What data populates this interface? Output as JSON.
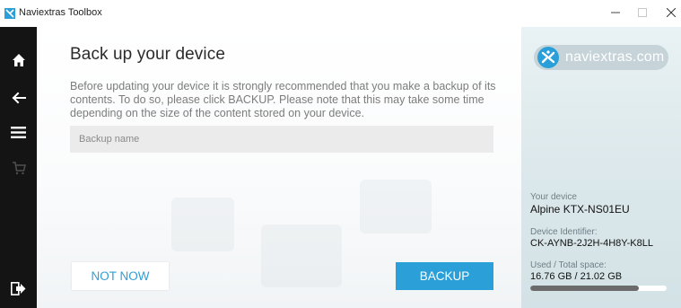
{
  "window": {
    "title": "Naviextras Toolbox",
    "controls": [
      "minimize",
      "maximize",
      "close"
    ]
  },
  "sidebar": {
    "items": [
      {
        "icon": "home-icon"
      },
      {
        "icon": "back-arrow-icon"
      },
      {
        "icon": "menu-icon"
      },
      {
        "icon": "cart-icon"
      },
      {
        "icon": "exit-icon"
      }
    ]
  },
  "main": {
    "title": "Back up your device",
    "intro": "Before updating your device it is strongly recommended that you make a backup of its contents. To do so, please click BACKUP. Please note that this may take some time depending on the size of the content stored on your device.",
    "backup_name": {
      "placeholder": "Backup name",
      "value": ""
    },
    "not_now_label": "NOT NOW",
    "backup_label": "BACKUP"
  },
  "panel": {
    "brand": "naviextras.com",
    "device_label": "Your device",
    "device_value": "Alpine KTX-NS01EU",
    "identifier_label": "Device Identifier:",
    "identifier_value": "CK-AYNB-2J2H-4H8Y-K8LL",
    "space_label": "Used / Total space:",
    "space_value": "16.76 GB / 21.02 GB",
    "storage_used_fraction": 0.797
  },
  "colors": {
    "accent": "#2a9fd8",
    "sidebar": "#141414",
    "panel": "#dde9ec"
  }
}
